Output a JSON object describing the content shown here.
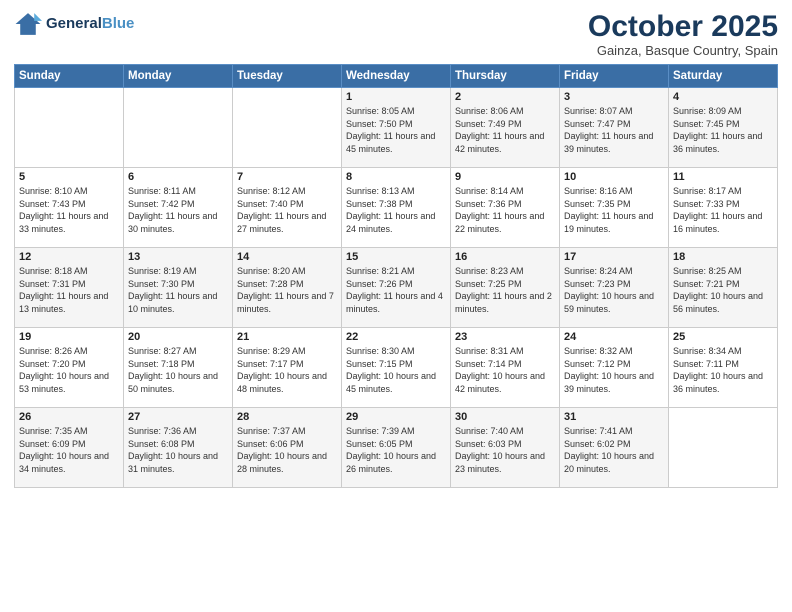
{
  "header": {
    "logo_line1": "General",
    "logo_line2": "Blue",
    "title": "October 2025",
    "location": "Gainza, Basque Country, Spain"
  },
  "days_of_week": [
    "Sunday",
    "Monday",
    "Tuesday",
    "Wednesday",
    "Thursday",
    "Friday",
    "Saturday"
  ],
  "weeks": [
    [
      {
        "day": "",
        "info": ""
      },
      {
        "day": "",
        "info": ""
      },
      {
        "day": "",
        "info": ""
      },
      {
        "day": "1",
        "info": "Sunrise: 8:05 AM\nSunset: 7:50 PM\nDaylight: 11 hours\nand 45 minutes."
      },
      {
        "day": "2",
        "info": "Sunrise: 8:06 AM\nSunset: 7:49 PM\nDaylight: 11 hours\nand 42 minutes."
      },
      {
        "day": "3",
        "info": "Sunrise: 8:07 AM\nSunset: 7:47 PM\nDaylight: 11 hours\nand 39 minutes."
      },
      {
        "day": "4",
        "info": "Sunrise: 8:09 AM\nSunset: 7:45 PM\nDaylight: 11 hours\nand 36 minutes."
      }
    ],
    [
      {
        "day": "5",
        "info": "Sunrise: 8:10 AM\nSunset: 7:43 PM\nDaylight: 11 hours\nand 33 minutes."
      },
      {
        "day": "6",
        "info": "Sunrise: 8:11 AM\nSunset: 7:42 PM\nDaylight: 11 hours\nand 30 minutes."
      },
      {
        "day": "7",
        "info": "Sunrise: 8:12 AM\nSunset: 7:40 PM\nDaylight: 11 hours\nand 27 minutes."
      },
      {
        "day": "8",
        "info": "Sunrise: 8:13 AM\nSunset: 7:38 PM\nDaylight: 11 hours\nand 24 minutes."
      },
      {
        "day": "9",
        "info": "Sunrise: 8:14 AM\nSunset: 7:36 PM\nDaylight: 11 hours\nand 22 minutes."
      },
      {
        "day": "10",
        "info": "Sunrise: 8:16 AM\nSunset: 7:35 PM\nDaylight: 11 hours\nand 19 minutes."
      },
      {
        "day": "11",
        "info": "Sunrise: 8:17 AM\nSunset: 7:33 PM\nDaylight: 11 hours\nand 16 minutes."
      }
    ],
    [
      {
        "day": "12",
        "info": "Sunrise: 8:18 AM\nSunset: 7:31 PM\nDaylight: 11 hours\nand 13 minutes."
      },
      {
        "day": "13",
        "info": "Sunrise: 8:19 AM\nSunset: 7:30 PM\nDaylight: 11 hours\nand 10 minutes."
      },
      {
        "day": "14",
        "info": "Sunrise: 8:20 AM\nSunset: 7:28 PM\nDaylight: 11 hours\nand 7 minutes."
      },
      {
        "day": "15",
        "info": "Sunrise: 8:21 AM\nSunset: 7:26 PM\nDaylight: 11 hours\nand 4 minutes."
      },
      {
        "day": "16",
        "info": "Sunrise: 8:23 AM\nSunset: 7:25 PM\nDaylight: 11 hours\nand 2 minutes."
      },
      {
        "day": "17",
        "info": "Sunrise: 8:24 AM\nSunset: 7:23 PM\nDaylight: 10 hours\nand 59 minutes."
      },
      {
        "day": "18",
        "info": "Sunrise: 8:25 AM\nSunset: 7:21 PM\nDaylight: 10 hours\nand 56 minutes."
      }
    ],
    [
      {
        "day": "19",
        "info": "Sunrise: 8:26 AM\nSunset: 7:20 PM\nDaylight: 10 hours\nand 53 minutes."
      },
      {
        "day": "20",
        "info": "Sunrise: 8:27 AM\nSunset: 7:18 PM\nDaylight: 10 hours\nand 50 minutes."
      },
      {
        "day": "21",
        "info": "Sunrise: 8:29 AM\nSunset: 7:17 PM\nDaylight: 10 hours\nand 48 minutes."
      },
      {
        "day": "22",
        "info": "Sunrise: 8:30 AM\nSunset: 7:15 PM\nDaylight: 10 hours\nand 45 minutes."
      },
      {
        "day": "23",
        "info": "Sunrise: 8:31 AM\nSunset: 7:14 PM\nDaylight: 10 hours\nand 42 minutes."
      },
      {
        "day": "24",
        "info": "Sunrise: 8:32 AM\nSunset: 7:12 PM\nDaylight: 10 hours\nand 39 minutes."
      },
      {
        "day": "25",
        "info": "Sunrise: 8:34 AM\nSunset: 7:11 PM\nDaylight: 10 hours\nand 36 minutes."
      }
    ],
    [
      {
        "day": "26",
        "info": "Sunrise: 7:35 AM\nSunset: 6:09 PM\nDaylight: 10 hours\nand 34 minutes."
      },
      {
        "day": "27",
        "info": "Sunrise: 7:36 AM\nSunset: 6:08 PM\nDaylight: 10 hours\nand 31 minutes."
      },
      {
        "day": "28",
        "info": "Sunrise: 7:37 AM\nSunset: 6:06 PM\nDaylight: 10 hours\nand 28 minutes."
      },
      {
        "day": "29",
        "info": "Sunrise: 7:39 AM\nSunset: 6:05 PM\nDaylight: 10 hours\nand 26 minutes."
      },
      {
        "day": "30",
        "info": "Sunrise: 7:40 AM\nSunset: 6:03 PM\nDaylight: 10 hours\nand 23 minutes."
      },
      {
        "day": "31",
        "info": "Sunrise: 7:41 AM\nSunset: 6:02 PM\nDaylight: 10 hours\nand 20 minutes."
      },
      {
        "day": "",
        "info": ""
      }
    ]
  ]
}
